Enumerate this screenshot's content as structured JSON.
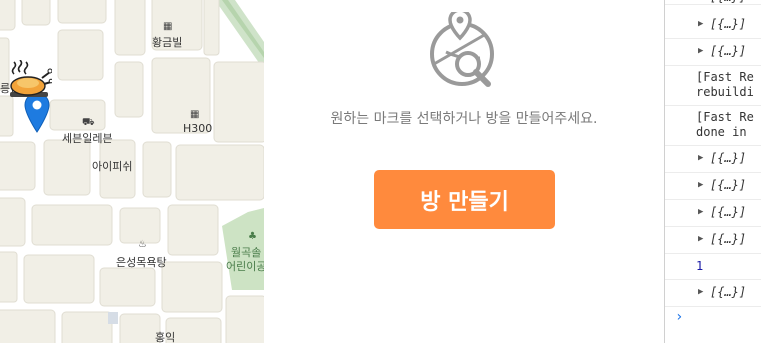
{
  "map": {
    "places": {
      "golden_villa": "황금빌",
      "seven_eleven": "세븐일레븐",
      "h300": "H300",
      "ipichui": "아이피쉬",
      "eunseong_bath": "은성목욕탕",
      "park": "월곡솔",
      "kindergarten": "어린이공",
      "hongik": "홍익",
      "partial_left": "릉당"
    },
    "marker_icons": [
      "chicken-marker-icon",
      "pin-icon"
    ]
  },
  "center": {
    "empty_message": "원하는 마크를 선택하거나 방을 만들어주세요.",
    "create_button_label": "방 만들기",
    "accent_color": "#ff8a3d"
  },
  "console": {
    "rows": [
      {
        "kind": "object",
        "text": "[{…}]"
      },
      {
        "kind": "object",
        "text": "[{…}]"
      },
      {
        "kind": "message",
        "line1": "[Fast Re",
        "line2": "rebuildi"
      },
      {
        "kind": "message",
        "line1": "[Fast Re",
        "line2": "done in"
      },
      {
        "kind": "object",
        "text": "[{…}]"
      },
      {
        "kind": "object",
        "text": "[{…}]"
      },
      {
        "kind": "object",
        "text": "[{…}]"
      },
      {
        "kind": "object",
        "text": "[{…}]"
      },
      {
        "kind": "number",
        "text": "1"
      },
      {
        "kind": "object",
        "text": "[{…}]"
      }
    ],
    "partial_top": "[{…}]",
    "prompt": "›"
  }
}
